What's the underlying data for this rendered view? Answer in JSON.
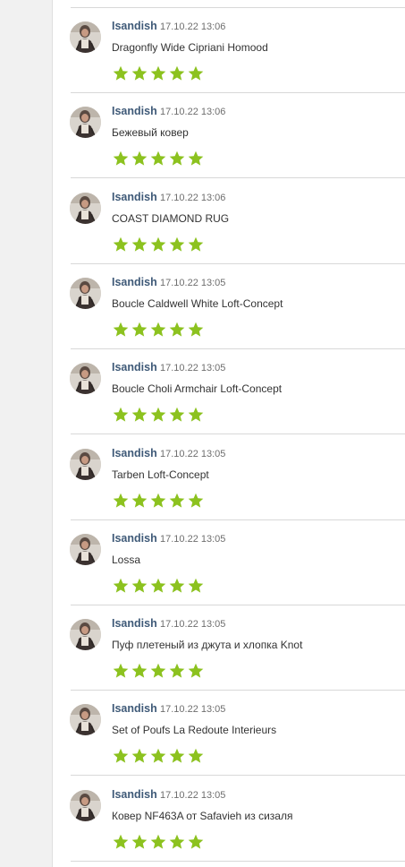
{
  "accent_star_color": "#8cc21f",
  "reviews": [
    {
      "user": "Isandish",
      "date": "17.10.22 13:06",
      "product": "Dragonfly Wide Cipriani Homood",
      "rating": 5
    },
    {
      "user": "Isandish",
      "date": "17.10.22 13:06",
      "product": "Бежевый ковер",
      "rating": 5
    },
    {
      "user": "Isandish",
      "date": "17.10.22 13:06",
      "product": "COAST DIAMOND RUG",
      "rating": 5
    },
    {
      "user": "Isandish",
      "date": "17.10.22 13:05",
      "product": "Boucle Caldwell White Loft-Concept",
      "rating": 5
    },
    {
      "user": "Isandish",
      "date": "17.10.22 13:05",
      "product": "Boucle Choli Armchair Loft-Concept",
      "rating": 5
    },
    {
      "user": "Isandish",
      "date": "17.10.22 13:05",
      "product": "Tarben Loft-Concept",
      "rating": 5
    },
    {
      "user": "Isandish",
      "date": "17.10.22 13:05",
      "product": "Lossa",
      "rating": 5
    },
    {
      "user": "Isandish",
      "date": "17.10.22 13:05",
      "product": "Пуф плетеный из джута и хлопка Knot",
      "rating": 5
    },
    {
      "user": "Isandish",
      "date": "17.10.22 13:05",
      "product": "Set of Poufs La Redoute Interieurs",
      "rating": 5
    },
    {
      "user": "Isandish",
      "date": "17.10.22 13:05",
      "product": "Ковер NF463A от Safavieh из сизаля",
      "rating": 5
    }
  ]
}
